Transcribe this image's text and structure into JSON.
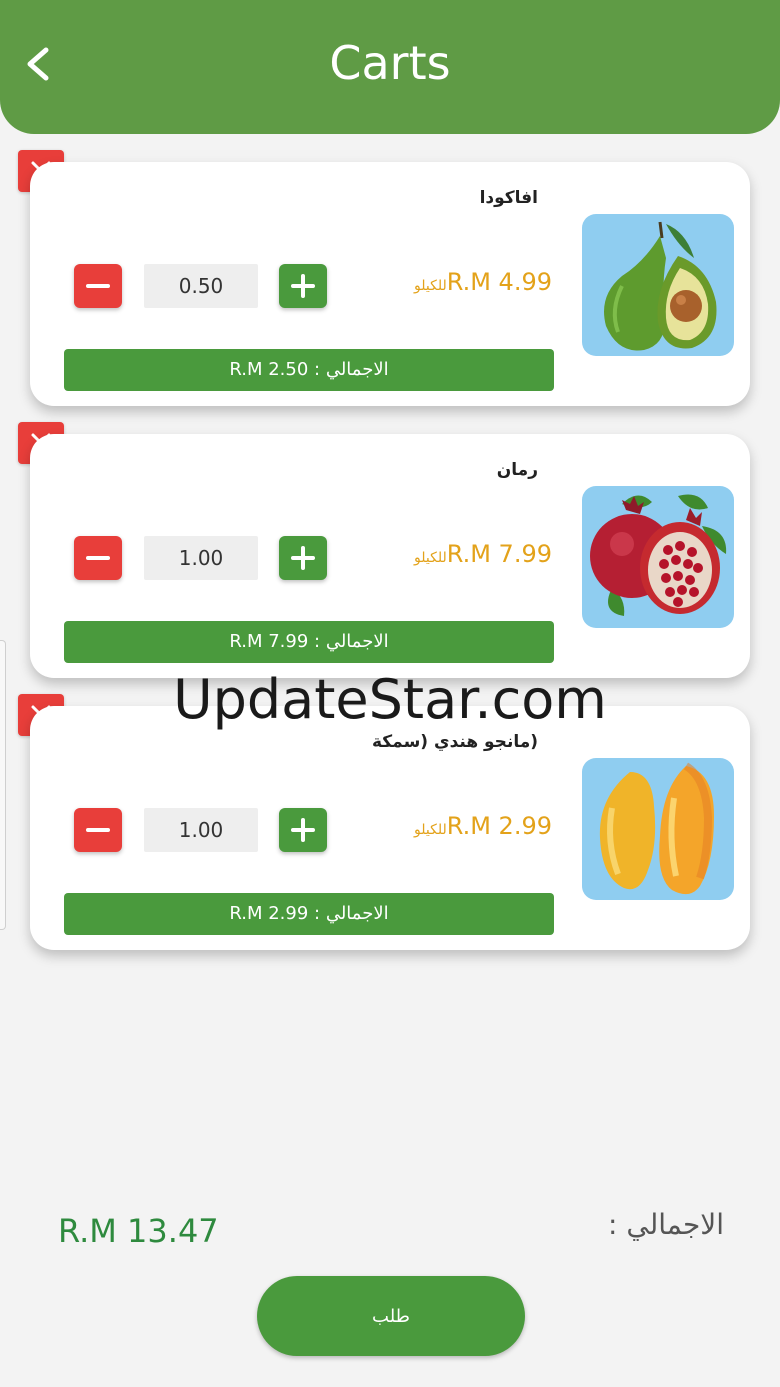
{
  "header": {
    "title": "Carts"
  },
  "items": [
    {
      "name": "افاكودا",
      "price": "R.M 4.99",
      "unit": "للكيلو",
      "qty": "0.50",
      "total": "الاجمالي : R.M 2.50",
      "image": "avocado"
    },
    {
      "name": "رمان",
      "price": "R.M 7.99",
      "unit": "للكيلو",
      "qty": "1.00",
      "total": "الاجمالي : R.M 7.99",
      "image": "pomegranate"
    },
    {
      "name": "(مانجو هندي (سمكة",
      "price": "R.M 2.99",
      "unit": "للكيلو",
      "qty": "1.00",
      "total": "الاجمالي : R.M 2.99",
      "image": "mango"
    }
  ],
  "summary": {
    "label": "الاجمالي :",
    "total": "R.M 13.47"
  },
  "order_button": "طلب",
  "watermark": "UpdateStar.com",
  "colors": {
    "primary_green": "#4a9a3d",
    "header_green": "#5f9b45",
    "remove_red": "#e83e3a",
    "price_orange": "#e3a21a",
    "total_text_green": "#2e8a3e"
  },
  "icons": {
    "back": "chevron-left-icon",
    "remove": "close-icon",
    "minus": "minus-icon",
    "plus": "plus-icon"
  }
}
